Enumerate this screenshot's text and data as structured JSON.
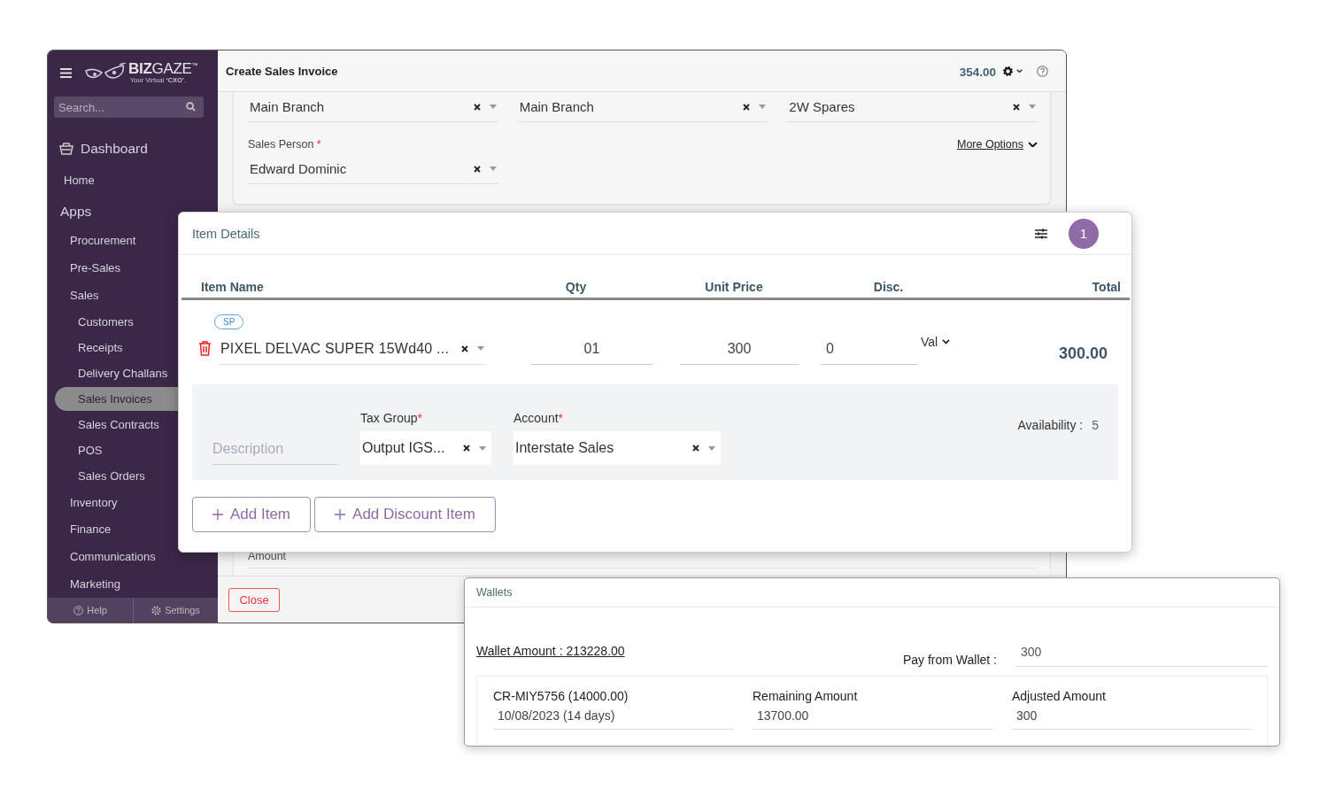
{
  "sidebar": {
    "logo": {
      "brand": "**BIZ**GAZE$^{™}$",
      "tagline": "Your Virtual **‘CXO’**."
    },
    "search": {
      "placeholder": "Search..."
    },
    "items": [
      {
        "label": "Dashboard",
        "kind": "heading",
        "selected": false,
        "children": [
          {
            "label": "Home",
            "kind": "link",
            "selected": false
          }
        ]
      },
      {
        "label": "Apps",
        "kind": "section",
        "selected": false,
        "children": [
          {
            "label": "Procurement",
            "kind": "link",
            "selected": false
          },
          {
            "label": "Pre-Sales",
            "kind": "link",
            "selected": false
          },
          {
            "label": "Sales",
            "kind": "link",
            "selected": false,
            "children": [
              {
                "label": "Customers",
                "kind": "link",
                "selected": false
              },
              {
                "label": "Receipts",
                "kind": "link",
                "selected": false
              },
              {
                "label": "Delivery Challans",
                "kind": "link",
                "selected": false
              },
              {
                "label": "Sales Invoices",
                "kind": "link",
                "selected": true
              },
              {
                "label": "Sales Contracts",
                "kind": "link",
                "selected": false
              },
              {
                "label": "POS",
                "kind": "link",
                "selected": false
              },
              {
                "label": "Sales Orders",
                "kind": "link",
                "selected": false
              }
            ]
          },
          {
            "label": "Inventory",
            "kind": "link",
            "selected": false
          },
          {
            "label": "Finance",
            "kind": "link",
            "selected": false
          },
          {
            "label": "Communications",
            "kind": "link",
            "selected": false
          },
          {
            "label": "Marketing",
            "kind": "link",
            "selected": false
          }
        ]
      }
    ],
    "footer": [
      {
        "label": "Help",
        "kind": "help"
      },
      {
        "label": "Settings",
        "kind": "settings"
      }
    ]
  },
  "main": {
    "title": "Create Sales Invoice",
    "balance": "354.00",
    "selects": [
      {
        "value": "Main Branch"
      },
      {
        "value": "Main Branch"
      },
      {
        "value": "2W Spares"
      }
    ],
    "sales_person": {
      "label": "Sales Person",
      "required_mark": "*",
      "value": "Edward Dominic"
    },
    "more_options": "More Options",
    "amount_label": "Amount",
    "close_button": "Close"
  },
  "item_details": {
    "title": "Item Details",
    "count": "1",
    "columns": [
      "Item Name",
      "Qty",
      "Unit Price",
      "Disc.",
      "Total"
    ],
    "rows": [
      {
        "tag": "SP",
        "name": "PIXEL DELVAC SUPER 15Wd40 ...",
        "qty": "01",
        "unit_price": "300",
        "discount": "0",
        "discount_type": "Val",
        "total": "300.00",
        "description": {
          "placeholder": "Description"
        },
        "tax_group": {
          "label": "Tax Group",
          "required_mark": "*",
          "value": "Output IGS..."
        },
        "account": {
          "label": "Account",
          "required_mark": "*",
          "value": "Interstate Sales"
        },
        "availability_label": "Availability :",
        "availability": "5"
      }
    ],
    "buttons": [
      "Add Item",
      "Add Discount Item"
    ]
  },
  "wallets": {
    "title": "Wallets",
    "wallet_amount": "Wallet Amount : 213228.00",
    "pay_label": "Pay from Wallet :",
    "pay_value": "300",
    "entries": [
      {
        "reference": "CR-MIY5756 (14000.00)",
        "date": "10/08/2023 (14 days)",
        "remaining_label": "Remaining Amount",
        "remaining": "13700.00",
        "adjusted_label": "Adjusted Amount",
        "adjusted": "300"
      }
    ]
  }
}
